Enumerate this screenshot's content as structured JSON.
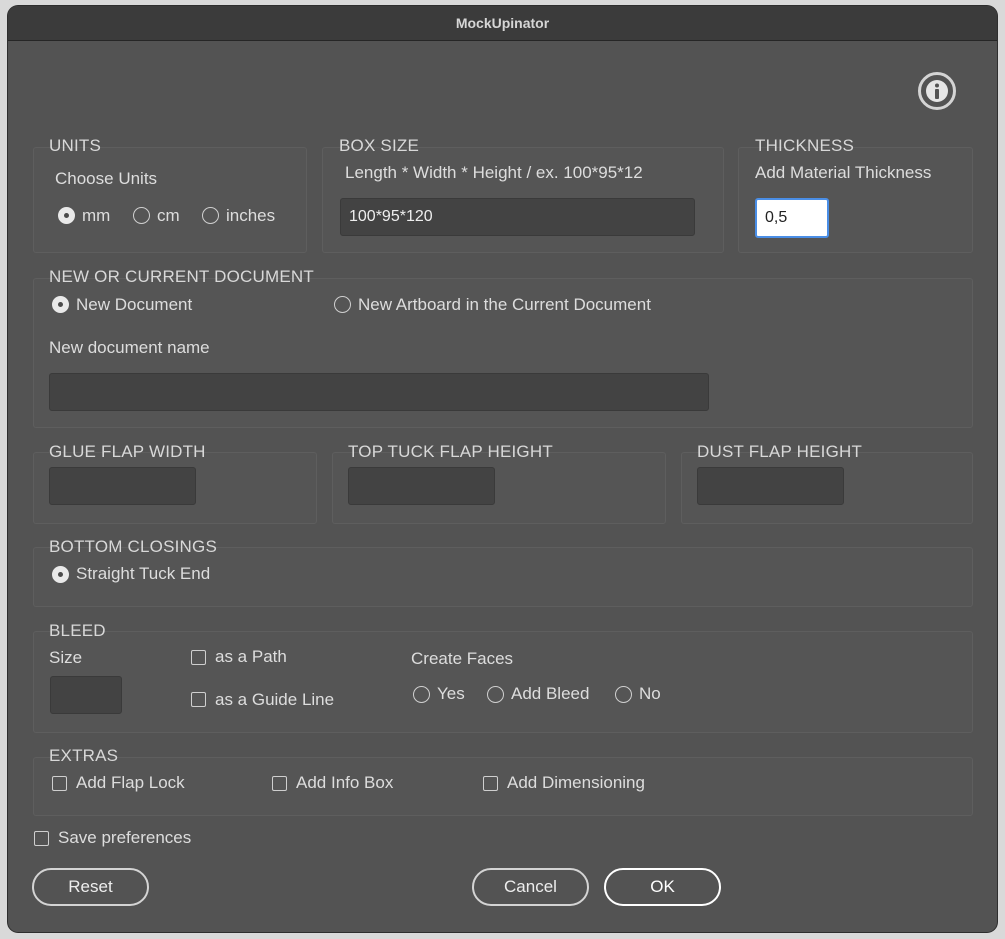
{
  "window": {
    "title": "MockUpinator"
  },
  "info_icon": "info-icon",
  "units": {
    "heading": "UNITS",
    "label": "Choose Units",
    "options": [
      "mm",
      "cm",
      "inches"
    ],
    "selected": "mm"
  },
  "box_size": {
    "heading": "BOX SIZE",
    "hint": "Length * Width * Height  / ex. 100*95*12",
    "value": "100*95*120"
  },
  "thickness": {
    "heading": "THICKNESS",
    "label": "Add Material Thickness",
    "value": "0,5"
  },
  "document": {
    "heading": "NEW OR CURRENT DOCUMENT",
    "options": [
      "New Document",
      "New Artboard in the Current Document"
    ],
    "selected": "New Document",
    "name_label": "New document name",
    "name_value": ""
  },
  "glue_flap": {
    "heading": "GLUE FLAP WIDTH",
    "value": ""
  },
  "top_tuck": {
    "heading": "TOP TUCK FLAP HEIGHT",
    "value": ""
  },
  "dust_flap": {
    "heading": "DUST FLAP HEIGHT",
    "value": ""
  },
  "bottom": {
    "heading": "BOTTOM CLOSINGS",
    "option": "Straight Tuck End",
    "selected": true
  },
  "bleed": {
    "heading": "BLEED",
    "size_label": "Size",
    "size_value": "",
    "as_path": "as a Path",
    "as_guide": "as a Guide Line",
    "faces_label": "Create Faces",
    "faces_options": [
      "Yes",
      "Add Bleed",
      "No"
    ]
  },
  "extras": {
    "heading": "EXTRAS",
    "options": [
      "Add Flap Lock",
      "Add Info Box",
      "Add Dimensioning"
    ]
  },
  "save_prefs": "Save preferences",
  "buttons": {
    "reset": "Reset",
    "cancel": "Cancel",
    "ok": "OK"
  },
  "colors": {
    "window_bg": "#535353",
    "titlebar": "#3b3b3b",
    "focus": "#4a8ee6"
  }
}
